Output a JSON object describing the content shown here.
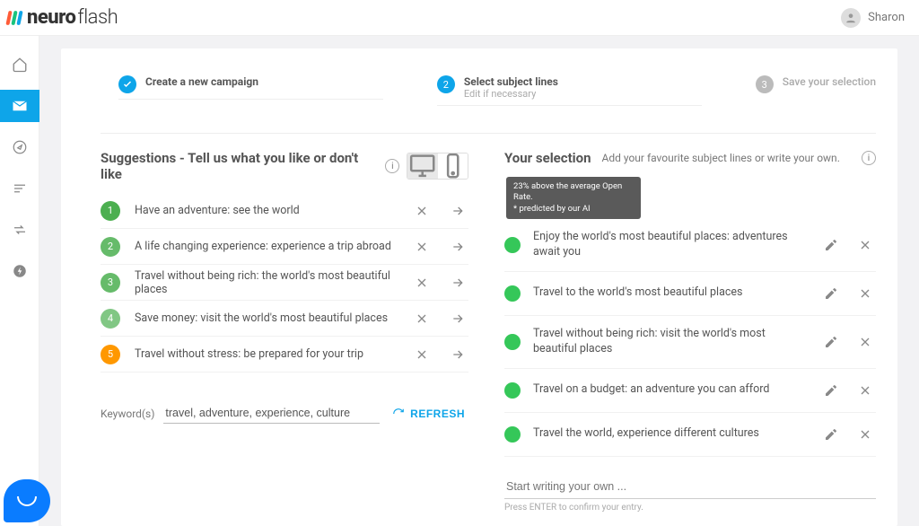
{
  "user": {
    "name": "Sharon"
  },
  "stepper": {
    "step1": {
      "title": "Create a new campaign"
    },
    "step2": {
      "title": "Select subject lines",
      "sub": "Edit if necessary",
      "num": "2"
    },
    "step3": {
      "title": "Save your selection",
      "num": "3"
    }
  },
  "suggestions": {
    "heading": "Suggestions - Tell us what you like or don't like",
    "items": [
      {
        "n": "1",
        "color": "#4caf50",
        "text": "Have an adventure: see the world"
      },
      {
        "n": "2",
        "color": "#66bb6a",
        "text": "A life changing experience: experience a trip abroad"
      },
      {
        "n": "3",
        "color": "#66bb6a",
        "text": "Travel without being rich: the world's most beautiful places"
      },
      {
        "n": "4",
        "color": "#81c784",
        "text": "Save money: visit the world's most beautiful places"
      },
      {
        "n": "5",
        "color": "#ff9800",
        "text": "Travel without stress: be prepared for your trip"
      }
    ]
  },
  "keywords": {
    "label": "Keyword(s)",
    "value": "travel, adventure, experience, culture",
    "refresh": "REFRESH"
  },
  "selection": {
    "heading": "Your selection",
    "hint": "Add your favourite subject lines or write your own.",
    "tooltip_line1": "23% above the average Open Rate.",
    "tooltip_line2": "* predicted by our AI",
    "items": [
      {
        "text": "Enjoy the world's most beautiful places: adventures await you"
      },
      {
        "text": "Travel to the world's most beautiful places"
      },
      {
        "text": "Travel without being rich: visit the world's most beautiful places"
      },
      {
        "text": "Travel on a budget: an adventure you can afford"
      },
      {
        "text": "Travel the world, experience different cultures"
      }
    ],
    "write_placeholder": "Start writing your own ...",
    "write_hint": "Press ENTER to confirm your entry."
  }
}
